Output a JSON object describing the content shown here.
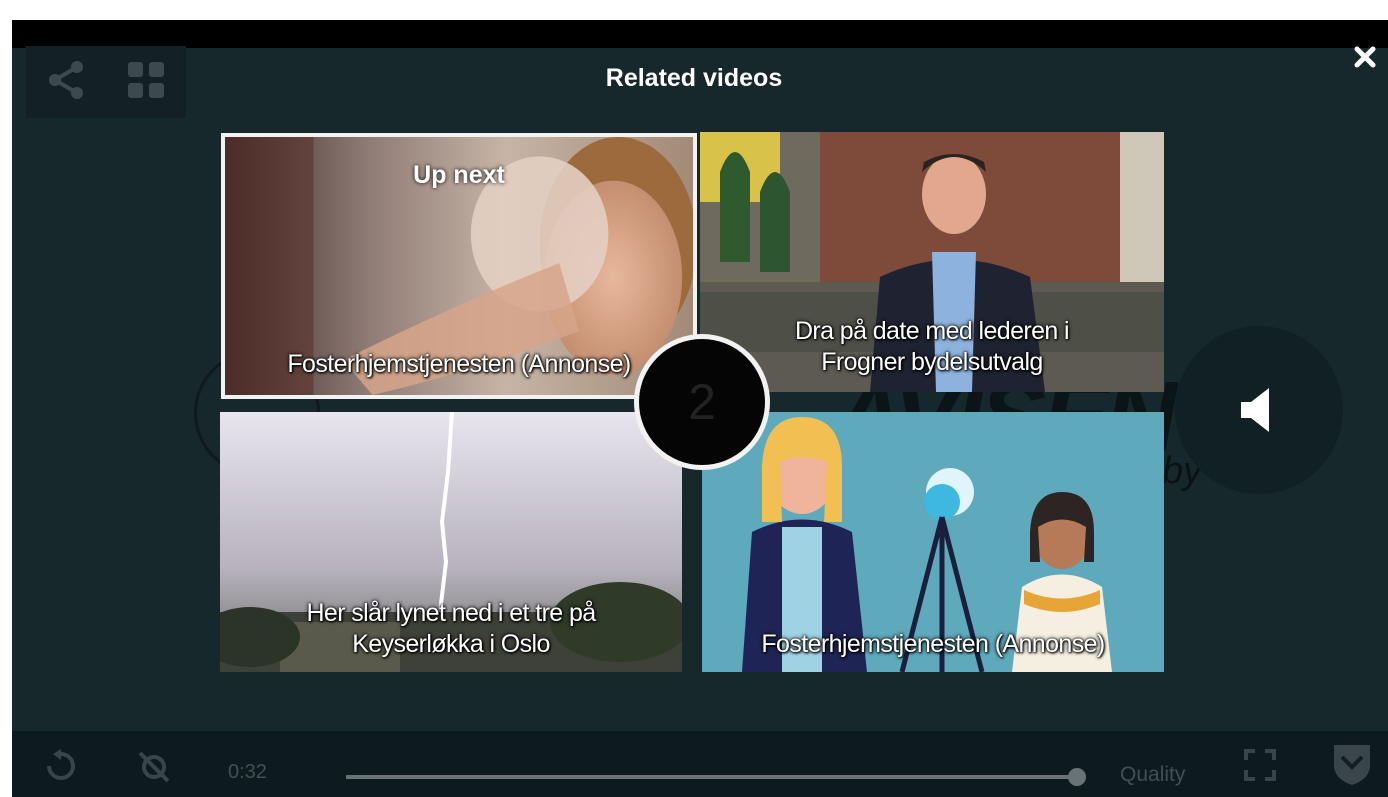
{
  "overlay": {
    "title": "Related videos",
    "countdown": "2"
  },
  "tiles": [
    {
      "badge": "Up next",
      "title": "Fosterhjemstjenesten (Annonse)"
    },
    {
      "title_line1": "Dra på date med lederen i",
      "title_line2": "Frogner bydelsutvalg"
    },
    {
      "title_line1": "Her slår lynet ned i et tre på",
      "title_line2": "Keyserløkka i Oslo"
    },
    {
      "title": "Fosterhjemstjenesten (Annonse)"
    }
  ],
  "controls": {
    "time": "0:32",
    "quality_label": "Quality",
    "progress_fraction": 0.99
  },
  "colors": {
    "background": "#17282c",
    "tile4_bg": "#5ea9bb"
  },
  "icons": [
    "share-icon",
    "grid-icon",
    "close-icon",
    "volume-icon",
    "replay-icon",
    "cast-off-icon",
    "fullscreen-icon",
    "brand-shield-icon"
  ]
}
